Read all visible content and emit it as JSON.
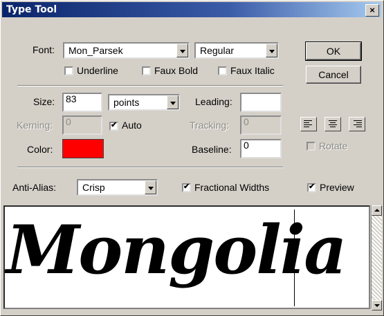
{
  "window": {
    "title": "Type Tool",
    "close_label": "×"
  },
  "font": {
    "label": "Font:",
    "family": "Mon_Parsek",
    "style": "Regular"
  },
  "styles": {
    "underline": {
      "label": "Underline",
      "checked": false
    },
    "faux_bold": {
      "label": "Faux Bold",
      "checked": false
    },
    "faux_italic": {
      "label": "Faux Italic",
      "checked": false
    }
  },
  "buttons": {
    "ok": "OK",
    "cancel": "Cancel"
  },
  "size": {
    "label": "Size:",
    "value": "83",
    "unit": "points"
  },
  "leading": {
    "label": "Leading:",
    "value": ""
  },
  "kerning": {
    "label": "Kerning:",
    "value": "0",
    "auto_label": "Auto",
    "auto_checked": true
  },
  "tracking": {
    "label": "Tracking:",
    "value": "0"
  },
  "color": {
    "label": "Color:",
    "swatch": "#ff0000"
  },
  "baseline": {
    "label": "Baseline:",
    "value": "0"
  },
  "alignment": {
    "options": [
      "align-left-icon",
      "align-center-icon",
      "align-right-icon"
    ],
    "selected": "align-left-icon"
  },
  "rotate": {
    "label": "Rotate",
    "checked": false
  },
  "anti_alias": {
    "label": "Anti-Alias:",
    "value": "Crisp"
  },
  "fractional_widths": {
    "label": "Fractional Widths",
    "checked": true
  },
  "preview": {
    "label": "Preview",
    "checked": true
  },
  "text_area": {
    "content": "Mongolia"
  },
  "colors": {
    "titlebar_start": "#0a246a",
    "dialog_bg": "#d4d0c8"
  }
}
